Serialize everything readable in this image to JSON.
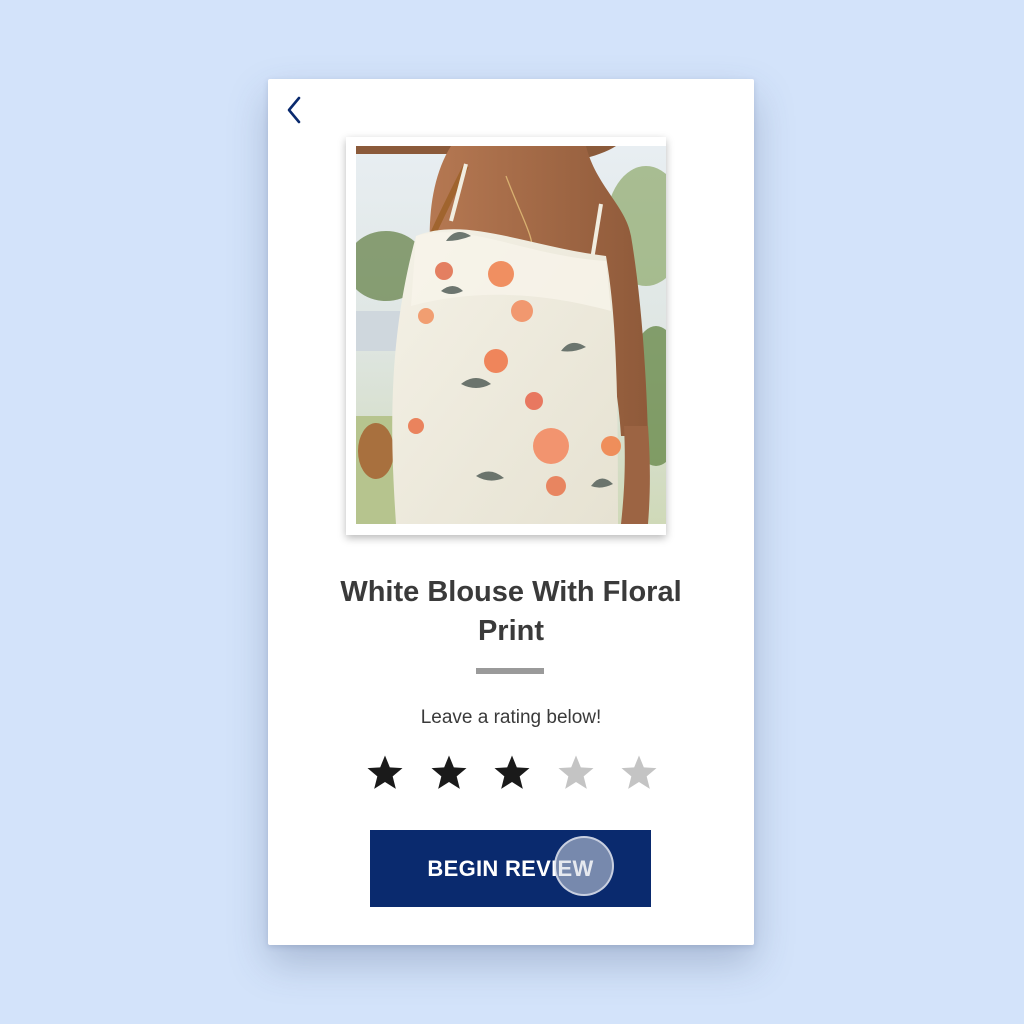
{
  "product": {
    "title": "White Blouse With Floral Print"
  },
  "rating": {
    "prompt": "Leave a rating below!",
    "max": 5,
    "value": 3,
    "filled_color": "#1a1a1a",
    "empty_color": "#c4c4c4"
  },
  "actions": {
    "begin_review_label": "BEGIN REVIEW"
  },
  "icons": {
    "back": "chevron-left-icon",
    "star": "star-icon"
  },
  "colors": {
    "page_background": "#d3e3fa",
    "accent": "#0a2a6e",
    "back_icon": "#0a2a6e"
  }
}
